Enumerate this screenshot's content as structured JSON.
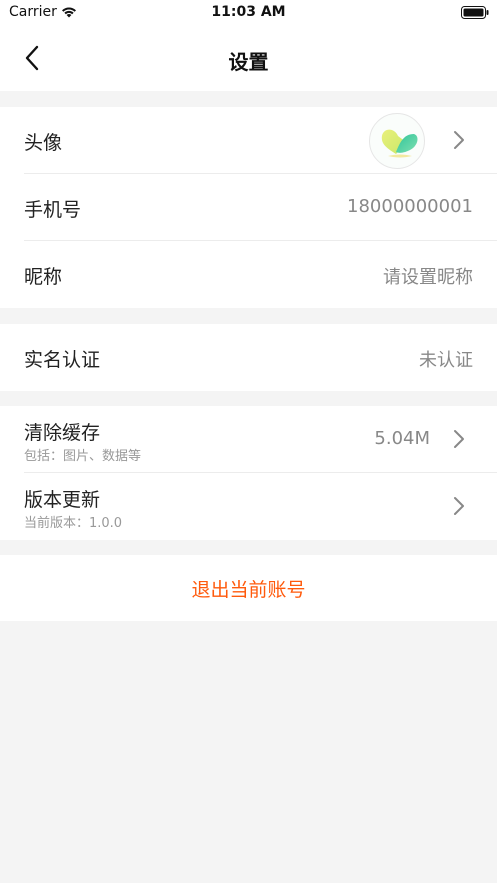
{
  "status_bar": {
    "carrier": "Carrier",
    "time": "11:03 AM",
    "wifi_icon": "wifi-icon",
    "battery_icon": "battery-icon"
  },
  "nav": {
    "title": "设置",
    "back_icon": "chevron-left-icon"
  },
  "profile": {
    "avatar": {
      "label": "头像",
      "icon": "avatar-image"
    },
    "phone": {
      "label": "手机号",
      "value": "18000000001"
    },
    "nickname": {
      "label": "昵称",
      "value": "请设置昵称"
    }
  },
  "verification": {
    "label": "实名认证",
    "value": "未认证"
  },
  "app": {
    "cache": {
      "label": "清除缓存",
      "sub": "包括：图片、数据等",
      "value": "5.04M"
    },
    "version": {
      "label": "版本更新",
      "sub": "当前版本：1.0.0"
    }
  },
  "logout": {
    "label": "退出当前账号"
  },
  "colors": {
    "accent": "#ff5a0c",
    "background": "#f4f4f4",
    "row_bg": "#ffffff",
    "label": "#222222",
    "value": "#888888",
    "sub": "#999999"
  }
}
